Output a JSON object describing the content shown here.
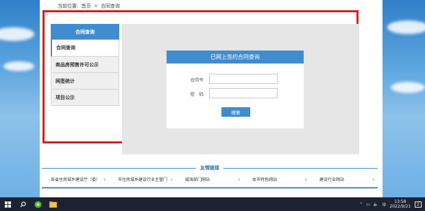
{
  "breadcrumb": {
    "prefix": "当前位置:",
    "home": "首页",
    "separator": ">",
    "current": "合同查询"
  },
  "sidebar": {
    "title": "合同查询",
    "items": [
      {
        "label": "合同查询"
      },
      {
        "label": "商品房预售许可公示"
      },
      {
        "label": "网签统计"
      },
      {
        "label": "项目公示"
      }
    ]
  },
  "form": {
    "title": "已网上签约合同查询",
    "contract_label": "合同号",
    "password_label": "密　码",
    "contract_value": "",
    "password_value": "",
    "search_label": "搜索"
  },
  "links": {
    "title": "友情链接",
    "selects": [
      {
        "label": "各省住房城乡建设厅（委）"
      },
      {
        "label": "市住房城乡建设行业主管门"
      },
      {
        "label": "威海部门网站"
      },
      {
        "label": "本市特色网站"
      },
      {
        "label": "建设行业网站"
      }
    ]
  },
  "taskbar": {
    "time": "13:58",
    "date": "2022/9/21",
    "notification_count": "2"
  },
  "colors": {
    "accent": "#3f8dcf",
    "highlight": "#d71c1c"
  }
}
